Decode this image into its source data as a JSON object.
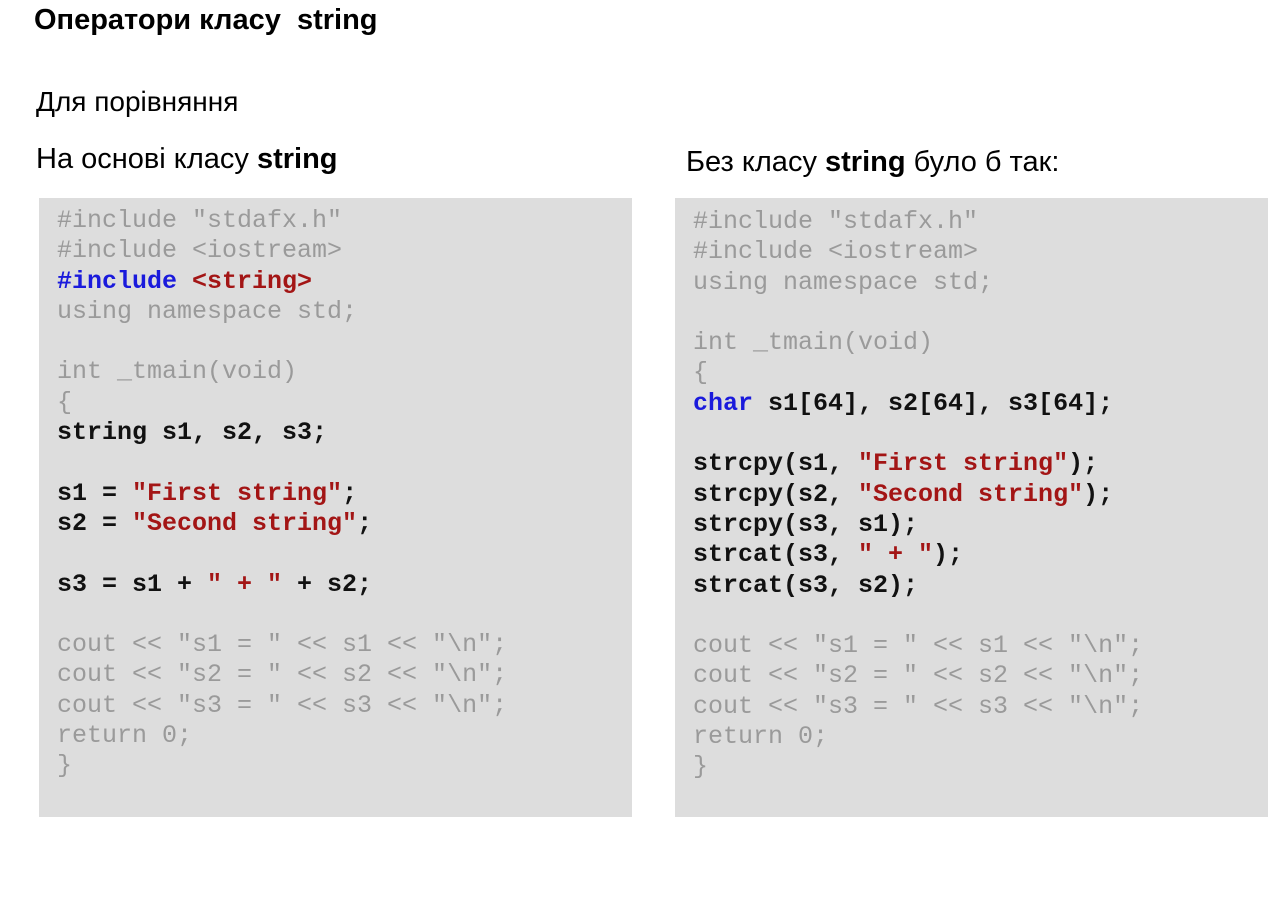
{
  "page": {
    "title": "Оператори класу  string",
    "subtitle": "Для порівняння"
  },
  "left": {
    "heading_prefix": "На основі класу ",
    "heading_bold": "string",
    "heading_suffix": "",
    "code": [
      [
        {
          "text": "#include \"stdafx.h\"",
          "style": "gray"
        }
      ],
      [
        {
          "text": "#include <iostream>",
          "style": "gray"
        }
      ],
      [
        {
          "text": "#include ",
          "style": "blue"
        },
        {
          "text": "<string>",
          "style": "red"
        }
      ],
      [
        {
          "text": "using namespace std;",
          "style": "gray"
        }
      ],
      [],
      [
        {
          "text": "int _tmain(void)",
          "style": "gray"
        }
      ],
      [
        {
          "text": "{",
          "style": "gray"
        }
      ],
      [
        {
          "text": "string s1, s2, s3;",
          "style": "black"
        }
      ],
      [],
      [
        {
          "text": "s1 = ",
          "style": "black"
        },
        {
          "text": "\"First string\"",
          "style": "red"
        },
        {
          "text": ";",
          "style": "black"
        }
      ],
      [
        {
          "text": "s2 = ",
          "style": "black"
        },
        {
          "text": "\"Second string\"",
          "style": "red"
        },
        {
          "text": ";",
          "style": "black"
        }
      ],
      [],
      [
        {
          "text": "s3 = s1 + ",
          "style": "black"
        },
        {
          "text": "\" + \"",
          "style": "red"
        },
        {
          "text": " + s2;",
          "style": "black"
        }
      ],
      [],
      [
        {
          "text": "cout << \"s1 = \" << s1 << \"\\n\";",
          "style": "gray"
        }
      ],
      [
        {
          "text": "cout << \"s2 = \" << s2 << \"\\n\";",
          "style": "gray"
        }
      ],
      [
        {
          "text": "cout << \"s3 = \" << s3 << \"\\n\";",
          "style": "gray"
        }
      ],
      [
        {
          "text": "return 0;",
          "style": "gray"
        }
      ],
      [
        {
          "text": "}",
          "style": "gray"
        }
      ]
    ]
  },
  "right": {
    "heading_prefix": "Без класу ",
    "heading_bold": "string",
    "heading_suffix": " було б так:",
    "code": [
      [
        {
          "text": "#include \"stdafx.h\"",
          "style": "gray"
        }
      ],
      [
        {
          "text": "#include <iostream>",
          "style": "gray"
        }
      ],
      [
        {
          "text": "using namespace std;",
          "style": "gray"
        }
      ],
      [],
      [
        {
          "text": "int _tmain(void)",
          "style": "gray"
        }
      ],
      [
        {
          "text": "{",
          "style": "gray"
        }
      ],
      [
        {
          "text": "char",
          "style": "blue"
        },
        {
          "text": " s1[64], s2[64], s3[64];",
          "style": "black"
        }
      ],
      [],
      [
        {
          "text": "strcpy(s1, ",
          "style": "black"
        },
        {
          "text": "\"First string\"",
          "style": "red"
        },
        {
          "text": ");",
          "style": "black"
        }
      ],
      [
        {
          "text": "strcpy(s2, ",
          "style": "black"
        },
        {
          "text": "\"Second string\"",
          "style": "red"
        },
        {
          "text": ");",
          "style": "black"
        }
      ],
      [
        {
          "text": "strcpy(s3, s1);",
          "style": "black"
        }
      ],
      [
        {
          "text": "strcat(s3, ",
          "style": "black"
        },
        {
          "text": "\" + \"",
          "style": "red"
        },
        {
          "text": ");",
          "style": "black"
        }
      ],
      [
        {
          "text": "strcat(s3, s2);",
          "style": "black"
        }
      ],
      [],
      [
        {
          "text": "cout << \"s1 = \" << s1 << \"\\n\";",
          "style": "gray"
        }
      ],
      [
        {
          "text": "cout << \"s2 = \" << s2 << \"\\n\";",
          "style": "gray"
        }
      ],
      [
        {
          "text": "cout << \"s3 = \" << s3 << \"\\n\";",
          "style": "gray"
        }
      ],
      [
        {
          "text": "return 0;",
          "style": "gray"
        }
      ],
      [
        {
          "text": "}",
          "style": "gray"
        }
      ]
    ]
  },
  "colors": {
    "panel_background": "#dddddd",
    "comment_gray": "#9a9a9a",
    "keyword_blue": "#1a1adc",
    "string_red": "#a31515"
  }
}
